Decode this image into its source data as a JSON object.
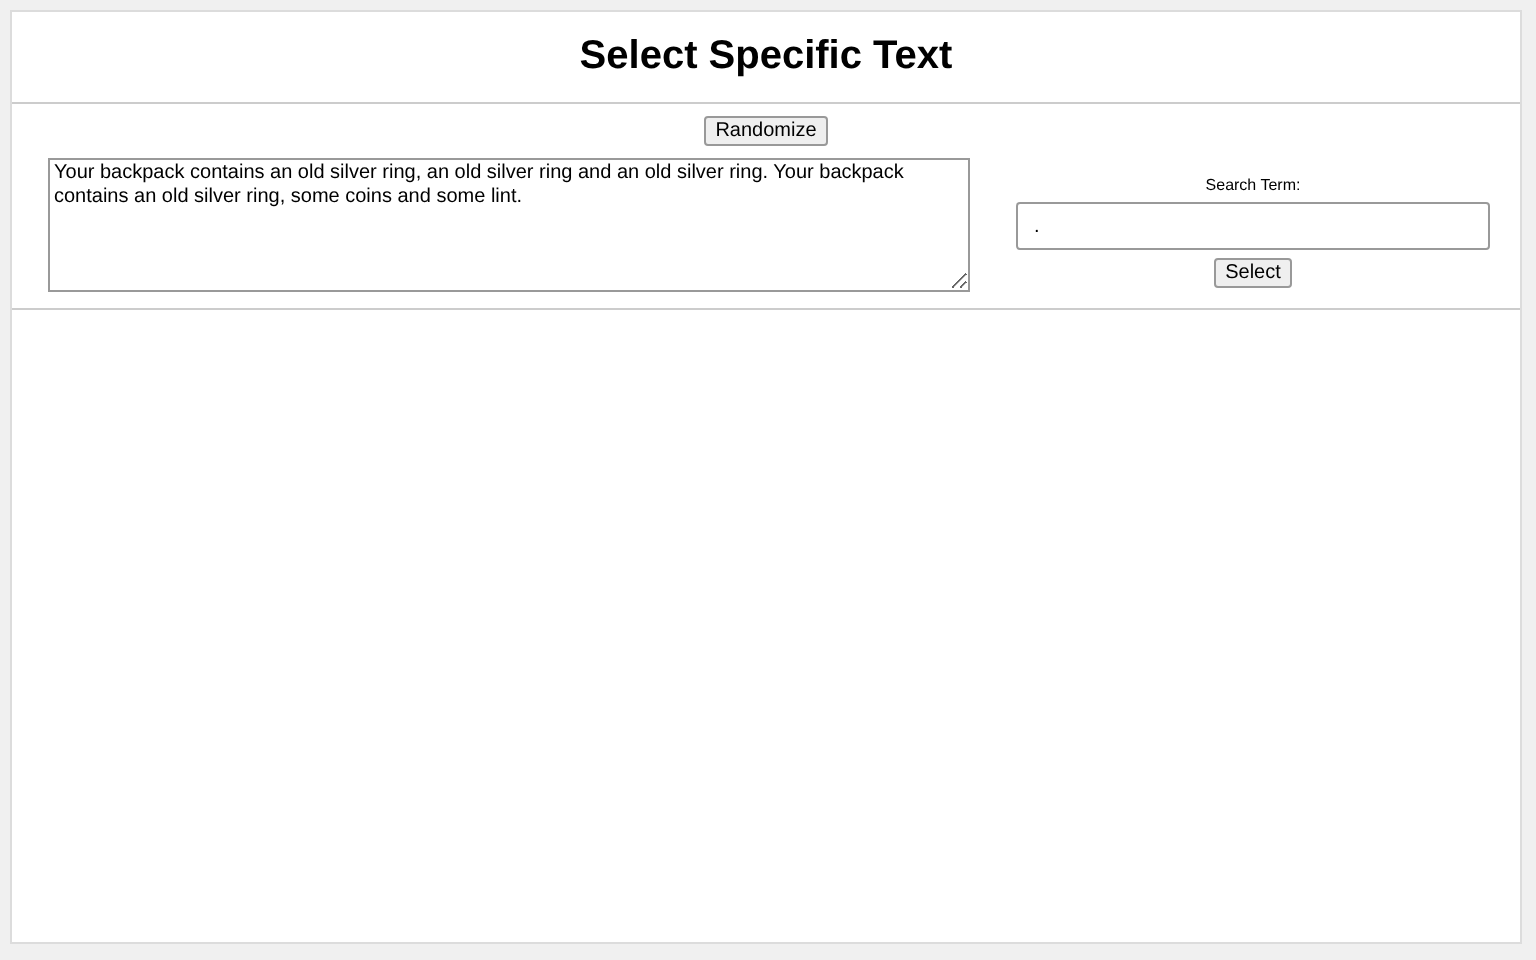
{
  "title": "Select Specific Text",
  "randomize_button": "Randomize",
  "text_area": {
    "value": "Your backpack contains an old silver ring, an old silver ring and an old silver ring. Your backpack contains an old silver ring, some coins and some lint."
  },
  "search": {
    "label": "Search Term:",
    "value": "."
  },
  "select_button": "Select"
}
